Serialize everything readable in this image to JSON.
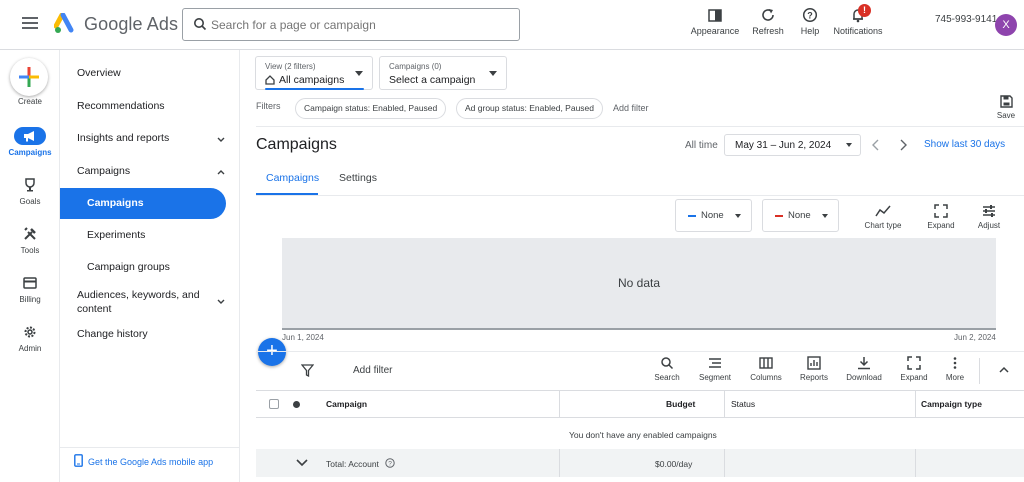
{
  "header": {
    "brand": "Google Ads",
    "search_placeholder": "Search for a page or campaign",
    "tools": [
      {
        "label": "Appearance",
        "icon": "appearance-icon"
      },
      {
        "label": "Refresh",
        "icon": "refresh-icon"
      },
      {
        "label": "Help",
        "icon": "help-icon"
      },
      {
        "label": "Notifications",
        "icon": "bell-icon",
        "badge": "!"
      }
    ],
    "account_id": "745-993-9141",
    "avatar_initial": "X"
  },
  "rail": {
    "create_label": "Create",
    "items": [
      {
        "label": "Campaigns",
        "icon": "megaphone-icon",
        "active": true
      },
      {
        "label": "Goals",
        "icon": "trophy-icon"
      },
      {
        "label": "Tools",
        "icon": "tools-icon"
      },
      {
        "label": "Billing",
        "icon": "credit-card-icon"
      },
      {
        "label": "Admin",
        "icon": "gear-icon"
      }
    ]
  },
  "nav": {
    "items": [
      {
        "label": "Overview"
      },
      {
        "label": "Recommendations"
      },
      {
        "label": "Insights and reports",
        "chevron": "down"
      },
      {
        "label": "Campaigns",
        "chevron": "up"
      }
    ],
    "sub_items": [
      {
        "label": "Campaigns",
        "active": true
      },
      {
        "label": "Experiments"
      },
      {
        "label": "Campaign groups"
      }
    ],
    "after_items": [
      {
        "label": "Audiences, keywords, and content",
        "chevron": "down"
      },
      {
        "label": "Change history"
      }
    ],
    "mobile_app_link": "Get the Google Ads mobile app"
  },
  "filters_bar": {
    "view_small": "View (2 filters)",
    "view_value": "All campaigns",
    "campaigns_small": "Campaigns (0)",
    "campaigns_value": "Select a campaign",
    "filters_label": "Filters",
    "chips": [
      "Campaign status: Enabled, Paused",
      "Ad group status: Enabled, Paused"
    ],
    "add_filter": "Add filter",
    "save_label": "Save"
  },
  "page": {
    "title": "Campaigns",
    "date_prefix": "All time",
    "date_range": "May 31 – Jun 2, 2024",
    "show_last": "Show last 30 days",
    "tabs": [
      "Campaigns",
      "Settings"
    ]
  },
  "chart_area": {
    "metric_1": {
      "label": "None",
      "color": "#1a73e8"
    },
    "metric_2": {
      "label": "None",
      "color": "#d93025"
    },
    "tools": [
      "Chart type",
      "Expand",
      "Adjust"
    ],
    "no_data": "No data",
    "x_start": "Jun 1, 2024",
    "x_end": "Jun 2, 2024"
  },
  "table": {
    "add_filter": "Add filter",
    "tools": [
      {
        "label": "Search",
        "icon": "search-icon"
      },
      {
        "label": "Segment",
        "icon": "segment-icon"
      },
      {
        "label": "Columns",
        "icon": "columns-icon"
      },
      {
        "label": "Reports",
        "icon": "reports-icon"
      },
      {
        "label": "Download",
        "icon": "download-icon"
      },
      {
        "label": "Expand",
        "icon": "expand-icon"
      },
      {
        "label": "More",
        "icon": "more-vert-icon"
      }
    ],
    "columns": [
      "Campaign",
      "Budget",
      "Status",
      "Campaign type"
    ],
    "empty_message": "You don't have any enabled campaigns",
    "total_label": "Total: Account",
    "total_budget": "$0.00/day"
  }
}
